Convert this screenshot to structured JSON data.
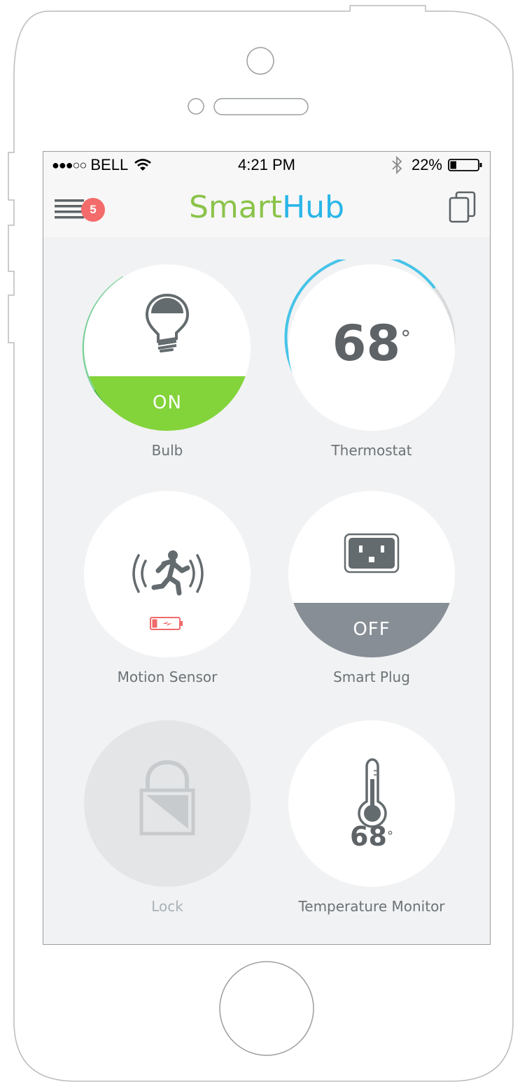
{
  "status_bar": {
    "signal": "●●●○○",
    "carrier": "BELL",
    "time": "4:21 PM",
    "battery": "22%",
    "battery_level": 0.22
  },
  "nav": {
    "title_part1": "Smart",
    "title_part2": "Hub",
    "notifications": "5"
  },
  "colors": {
    "green": "#8bc34a",
    "blue": "#29b5e8",
    "on_fill": "#82d43a",
    "off_fill": "#878e95",
    "badge": "#f36b6b",
    "icon_gray": "#646b6e"
  },
  "devices": [
    {
      "name": "Bulb",
      "state": "ON",
      "icon": "bulb-icon"
    },
    {
      "name": "Thermostat",
      "value": "68",
      "unit": "°",
      "icon": "thermostat-dial"
    },
    {
      "name": "Motion Sensor",
      "icon": "motion-sensor-icon",
      "battery": "low-battery-icon"
    },
    {
      "name": "Smart Plug",
      "state": "OFF",
      "icon": "outlet-icon"
    },
    {
      "name": "Lock",
      "icon": "lock-icon",
      "disabled": true
    },
    {
      "name": "Temperature Monitor",
      "value": "68",
      "unit": "°",
      "icon": "thermometer-icon"
    }
  ]
}
